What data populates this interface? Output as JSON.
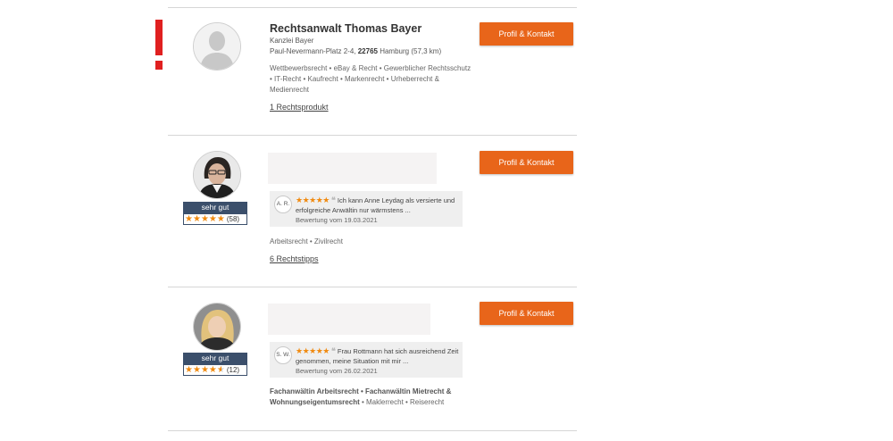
{
  "entries": [
    {
      "name": "Rechtsanwalt Thomas Bayer",
      "firm": "Kanzlei Bayer",
      "address_street": "Paul-Nevermann-Platz 2-4,",
      "address_zip": "22765",
      "address_city": "Hamburg (57,3 km)",
      "tags": "Wettbewerbsrecht • eBay & Recht • Gewerblicher Rechtsschutz • IT-Recht • Kaufrecht • Markenrecht • Urheberrecht & Medienrecht",
      "link": "1 Rechtsprodukt",
      "button": "Profil & Kontakt"
    },
    {
      "rating_label": "sehr gut",
      "rating_stars": 5,
      "rating_count": "(58)",
      "review_initials": "A. R.",
      "review_text": "Ich kann Anne Leydag als versierte und erfolgreiche Anwältin nur wärmstens ...",
      "review_date": "Bewertung vom 19.03.2021",
      "tags": "Arbeitsrecht • Zivilrecht",
      "link": "6 Rechtstipps",
      "button": "Profil & Kontakt"
    },
    {
      "rating_label": "sehr gut",
      "rating_stars": 4.5,
      "rating_count": "(12)",
      "review_initials": "S. W.",
      "review_text": "Frau Rottmann hat sich ausreichend Zeit genommen, meine Situation mit mir ...",
      "review_date": "Bewertung vom 26.02.2021",
      "tags_bold": "Fachanwältin Arbeitsrecht • Fachanwältin Mietrecht & Wohnungseigentumsrecht",
      "tags_rest": " • Maklerrecht • Reiserecht",
      "button": "Profil & Kontakt"
    }
  ],
  "colors": {
    "accent": "#e8651a",
    "rating_bar": "#3b4f6b",
    "star": "#f08a10",
    "alert": "#e02020"
  },
  "icons": {
    "alert": "exclamation-mark",
    "default_avatar": "person-silhouette",
    "review_stars": "★★★★★",
    "quote": "❝"
  }
}
